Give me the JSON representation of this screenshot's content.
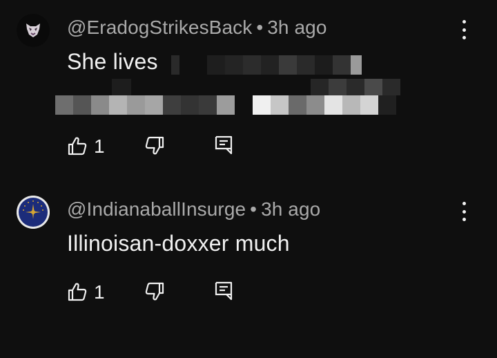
{
  "comments": [
    {
      "author": "@EradogStrikesBack",
      "separator": "•",
      "time": "3h ago",
      "text": "She lives",
      "likes": "1"
    },
    {
      "author": "@IndianaballInsurge",
      "separator": "•",
      "time": "3h ago",
      "text": "Illinoisan-doxxer much",
      "likes": "1"
    }
  ],
  "icons": {
    "like": "thumbs-up-icon",
    "dislike": "thumbs-down-icon",
    "reply": "reply-icon",
    "more": "more-vertical-icon"
  },
  "colors": {
    "background": "#0f0f0f",
    "text_primary": "#f1f1f1",
    "text_secondary": "#aaaaaa"
  }
}
